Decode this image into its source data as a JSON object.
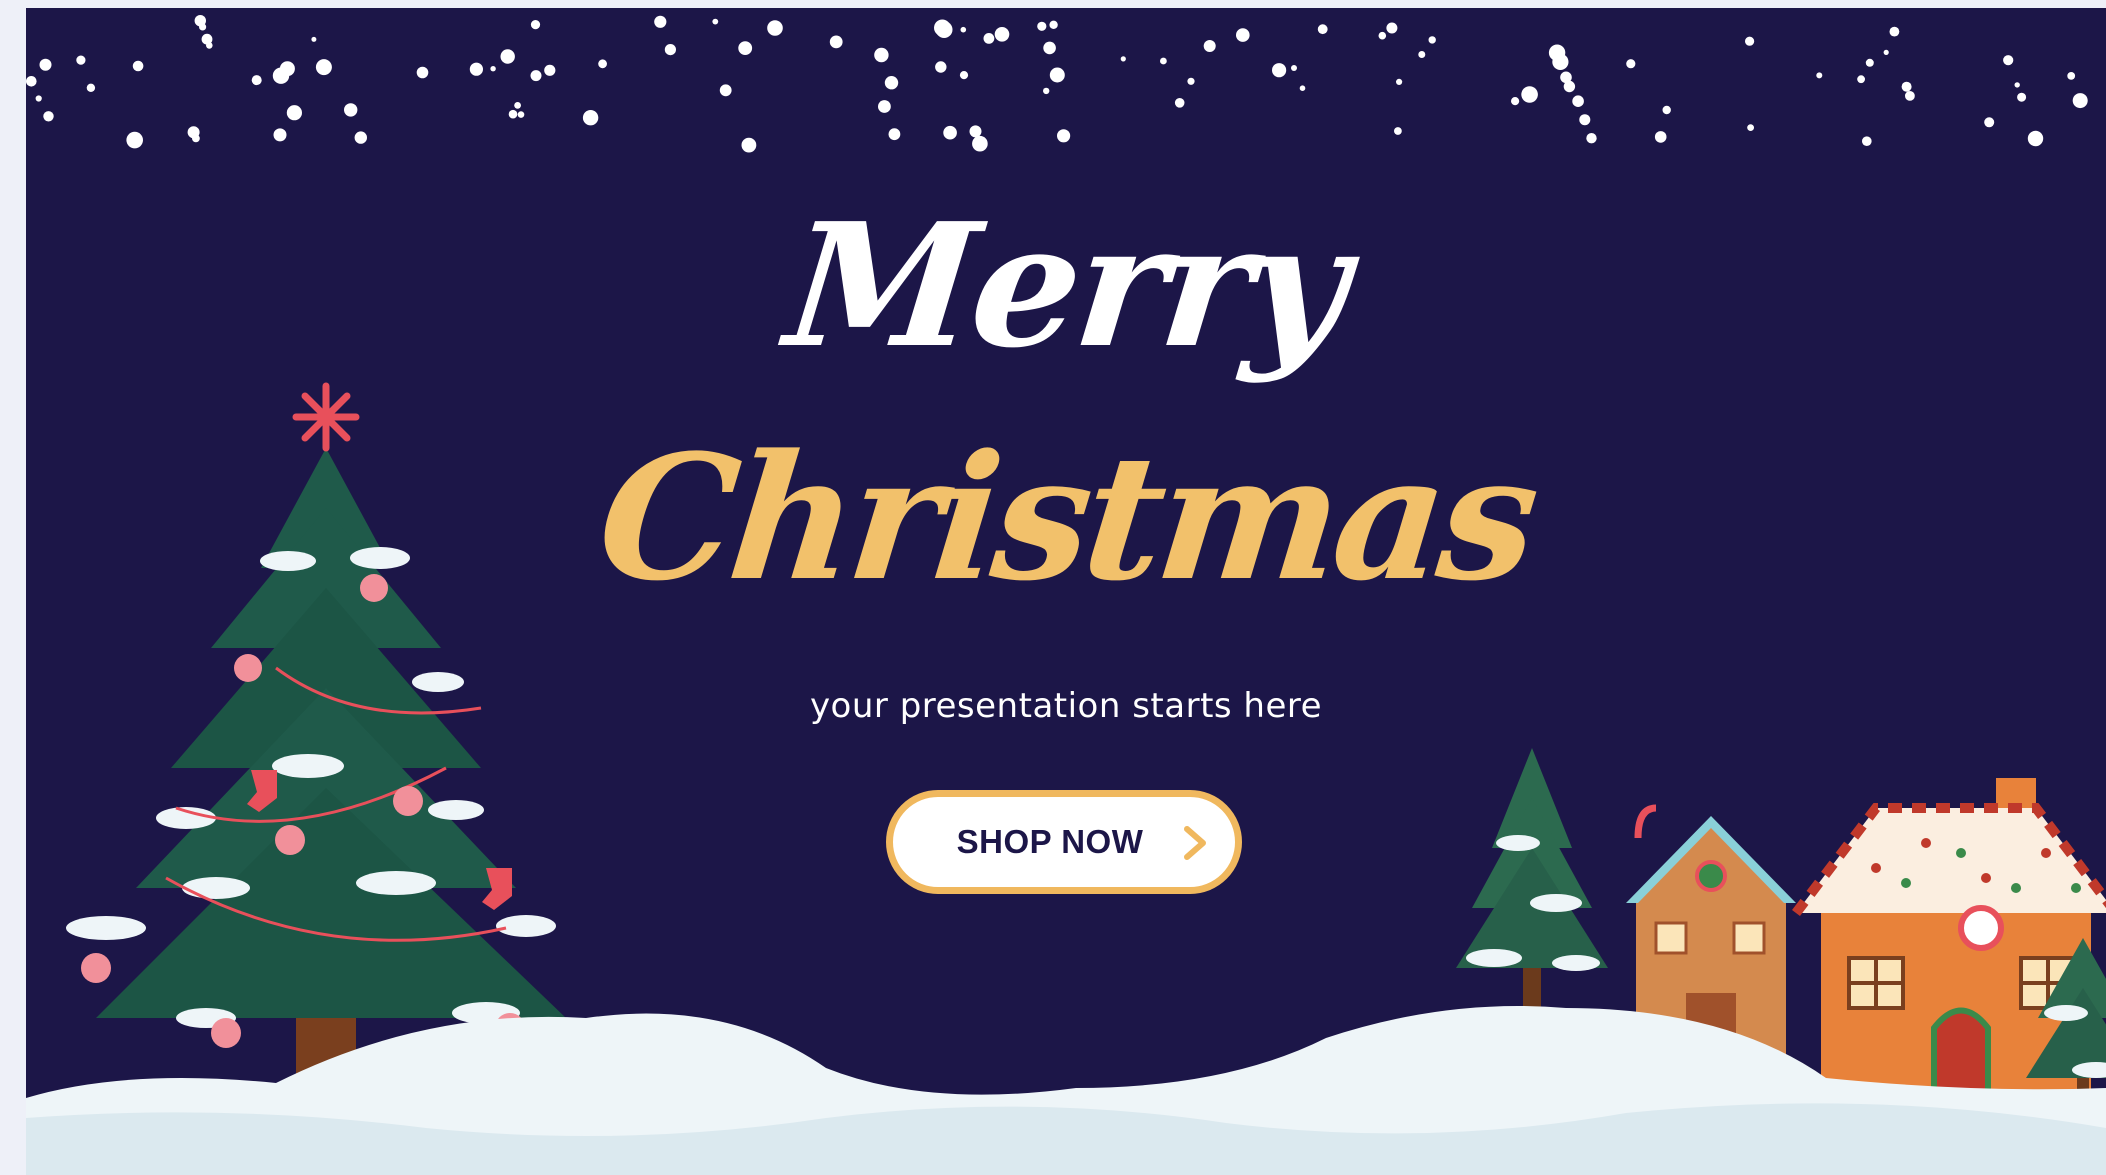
{
  "banner": {
    "title_line1": "Merry",
    "title_line2": "Christmas",
    "subtitle": "your presentation starts here",
    "cta_label": "SHOP NOW",
    "cta_icon": "chevron-right-icon"
  },
  "colors": {
    "background": "#1c1648",
    "title_line1": "#ffffff",
    "title_line2": "#f2c16b",
    "cta_border": "#f0b85e",
    "snow": "#eef5f8",
    "tree": "#1f5a4a",
    "gingerbread": "#e8823a"
  }
}
